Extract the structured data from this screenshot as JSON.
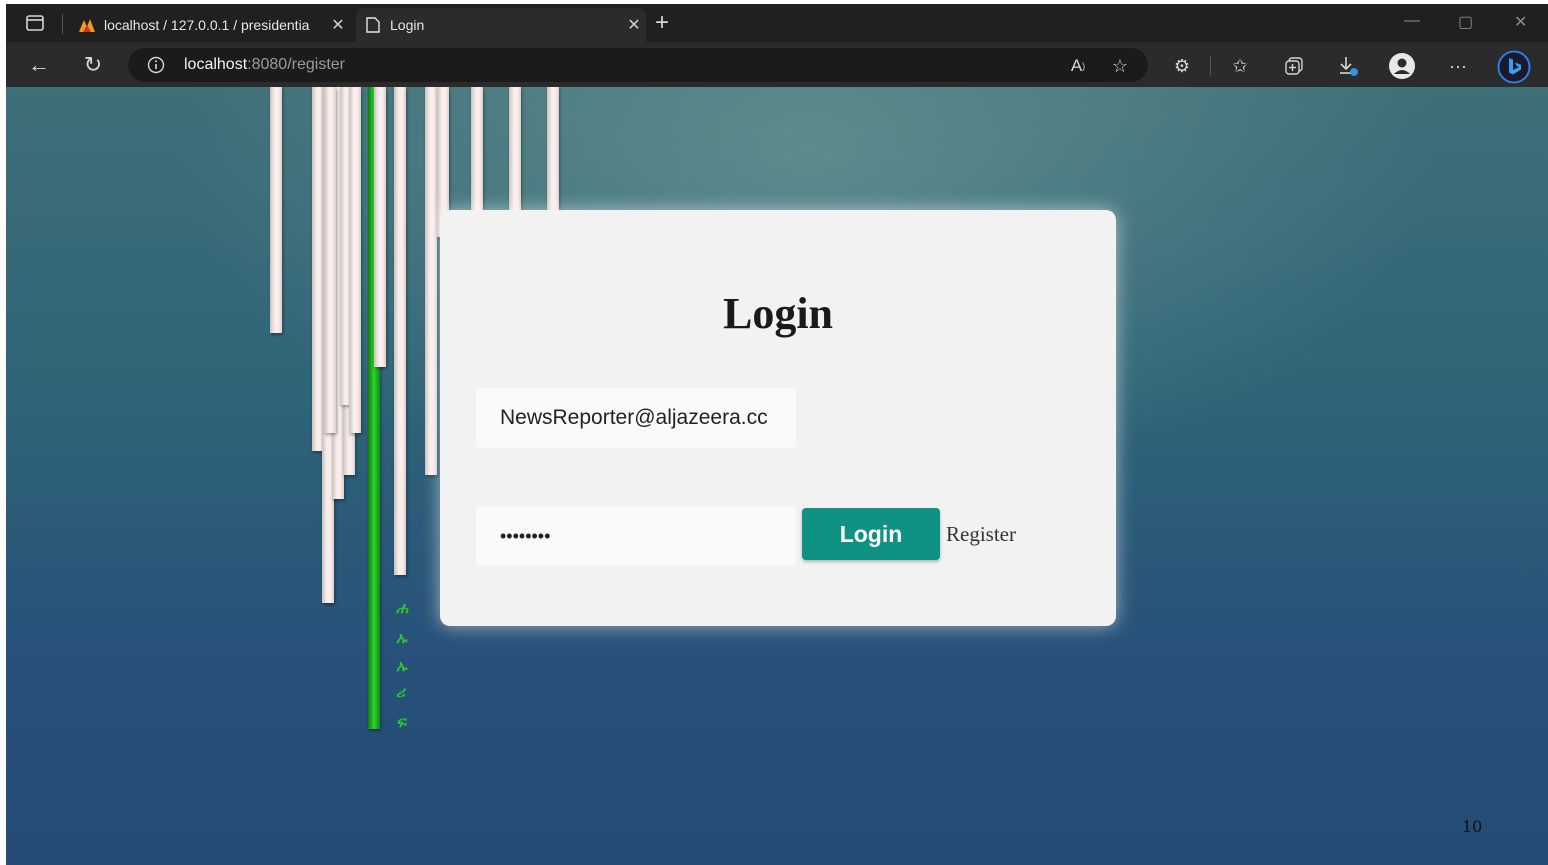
{
  "browser": {
    "tabs": [
      {
        "title": "localhost / 127.0.0.1 / presidentia",
        "active": false
      },
      {
        "title": "Login",
        "active": true
      }
    ],
    "new_tab_glyph": "+",
    "close_glyph": "✕",
    "address": {
      "host": "localhost",
      "path": ":8080/register"
    },
    "toolbar_icons": [
      "back-icon",
      "refresh-icon",
      "info-icon",
      "read-aloud-icon",
      "add-favorite-icon",
      "extensions-icon",
      "favorites-icon",
      "collections-icon",
      "downloads-icon",
      "profile-icon",
      "more-icon",
      "bing-icon"
    ]
  },
  "login": {
    "title": "Login",
    "email_value": "NewsReporter@aljazeera.cc",
    "password_mask": "••••••••",
    "login_button": "Login",
    "register_link": "Register"
  },
  "decor_glyphs": [
    "ሐ",
    "ኡ",
    "ኡ",
    "ሪ",
    "ፍ"
  ],
  "page_number": "10",
  "colors": {
    "button": "#0f9184",
    "card": "#f2f2f2",
    "accent_green": "#2ec52e"
  }
}
